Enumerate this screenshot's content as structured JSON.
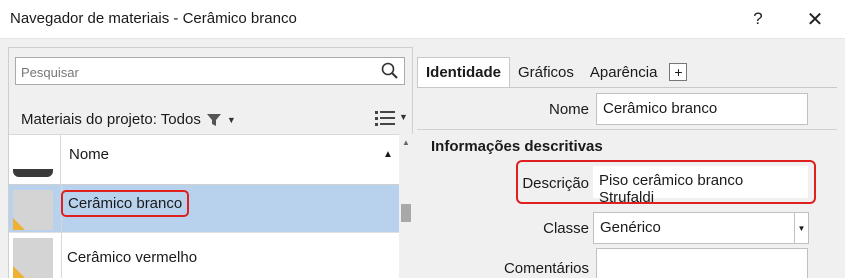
{
  "window": {
    "title": "Navegador de materiais - Cerâmico branco",
    "help_label": "?",
    "close_label": "✕"
  },
  "left_panel": {
    "search_placeholder": "Pesquisar",
    "project_label": "Materiais do projeto: Todos",
    "column_header": "Nome",
    "materials": [
      {
        "name": "Cerâmico branco",
        "selected": true
      },
      {
        "name": "Cerâmico vermelho",
        "selected": false
      }
    ]
  },
  "right_panel": {
    "tabs": [
      "Identidade",
      "Gráficos",
      "Aparência"
    ],
    "add_tab_label": "+",
    "name_label": "Nome",
    "name_value": "Cerâmico branco",
    "section_title": "Informações descritivas",
    "description_label": "Descrição",
    "description_value": "Piso cerâmico branco Strufaldi",
    "class_label": "Classe",
    "class_value": "Genérico",
    "comments_label": "Comentários",
    "comments_value": ""
  },
  "colors": {
    "highlight": "#e0201e",
    "selection": "#b8d2ee"
  }
}
